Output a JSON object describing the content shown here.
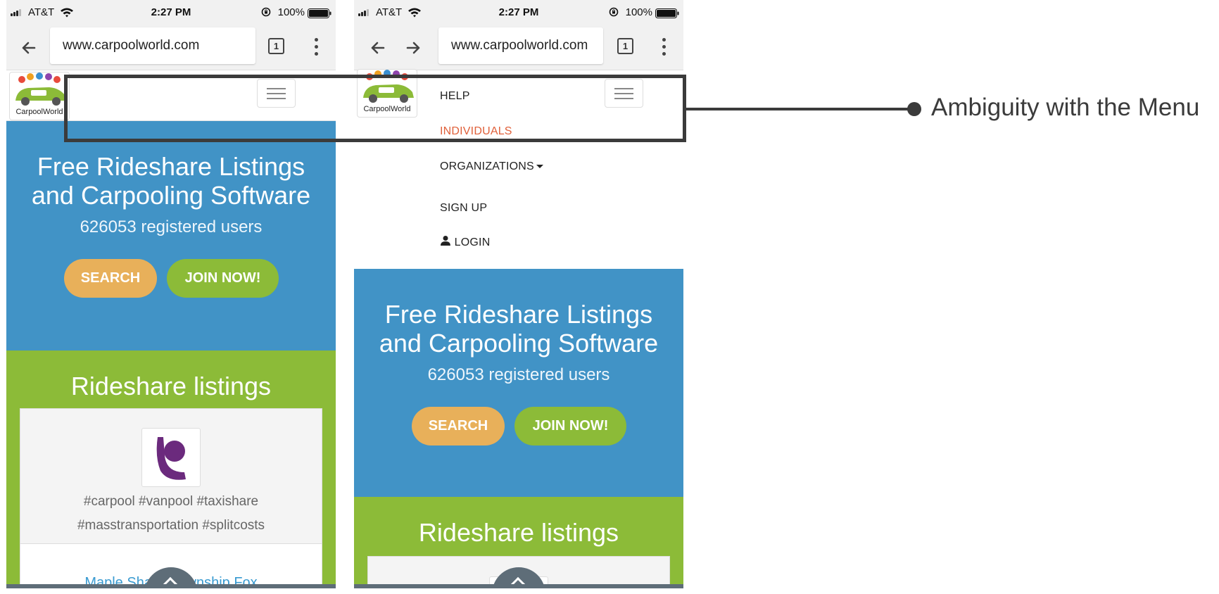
{
  "statusbar": {
    "carrier": "AT&T",
    "time": "2:27 PM",
    "battery": "100%"
  },
  "left_screen": {
    "url": "www.carpoolworld.com",
    "tab_count": "1",
    "logo_text": "CarpoolWorld",
    "hero": {
      "title_line1": "Free Rideshare Listings",
      "title_line2": "and Carpooling Software",
      "users": "626053 registered users",
      "search_label": "SEARCH",
      "join_label": "JOIN NOW!"
    },
    "listings": {
      "title": "Rideshare listings",
      "tags_line1": "#carpool #vanpool #taxishare",
      "tags_line2": "#masstransportation #splitcosts",
      "link": "Maple Shade Township Fox"
    }
  },
  "right_screen": {
    "url": "www.carpoolworld.com",
    "tab_count": "1",
    "logo_text": "CarpoolWorld",
    "menu": {
      "help": "HELP",
      "individuals": "INDIVIDUALS",
      "organizations": "ORGANIZATIONS",
      "sign_up": "SIGN UP",
      "login": "LOGIN"
    },
    "hero": {
      "title_line1": "Free Rideshare Listings",
      "title_line2": "and Carpooling Software",
      "users": "626053 registered users",
      "search_label": "SEARCH",
      "join_label": "JOIN NOW!"
    },
    "listings": {
      "title": "Rideshare listings"
    }
  },
  "annotation": {
    "label": "Ambiguity with the Menu"
  },
  "colors": {
    "hero_blue": "#4193c6",
    "listing_green": "#8cbb38",
    "search_orange": "#e8b05a",
    "active_menu": "#e0603a",
    "link_blue": "#3a9bd1",
    "annotation_dark": "#3b3b3b"
  },
  "icons": [
    "signal-icon",
    "wifi-icon",
    "orientation-lock-icon",
    "battery-icon",
    "back-arrow-icon",
    "forward-arrow-icon",
    "tabs-icon",
    "overflow-menu-icon",
    "hamburger-icon",
    "user-icon",
    "chevron-up-icon",
    "carpoolworld-logo"
  ]
}
